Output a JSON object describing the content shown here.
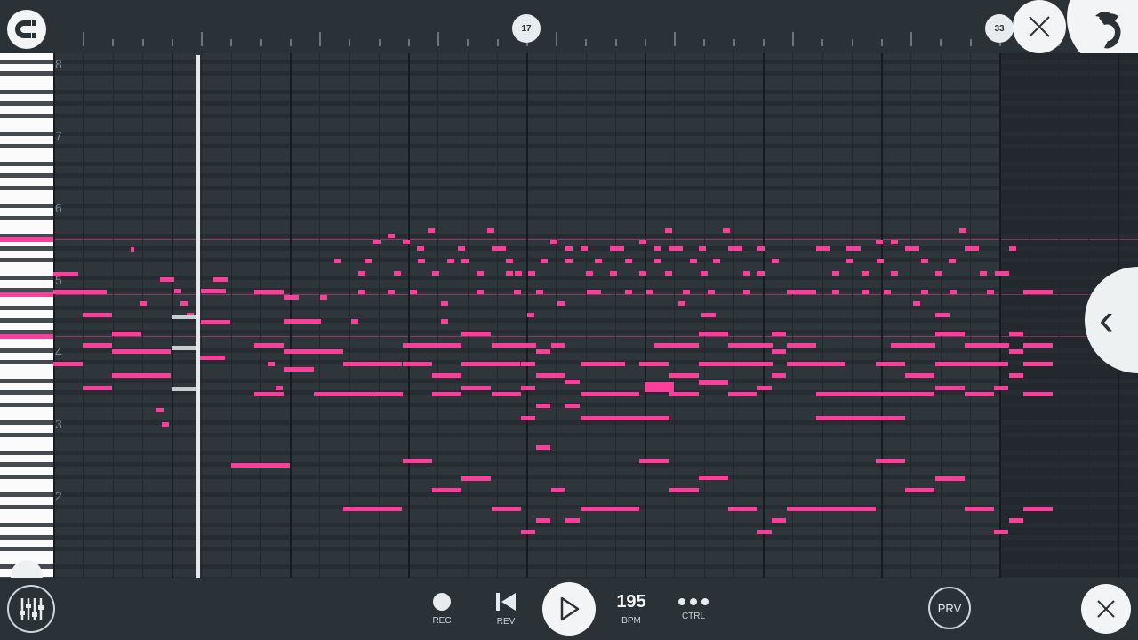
{
  "toolbar_top": {
    "markers": [
      {
        "label": "17"
      },
      {
        "label": "33"
      }
    ]
  },
  "octave_labels": [
    "8",
    "7",
    "6",
    "5",
    "4",
    "3",
    "2"
  ],
  "bottom_bar": {
    "rec_label": "REC",
    "rev_label": "REV",
    "bpm_value": "195",
    "bpm_label": "BPM",
    "ctrl_label": "CTRL",
    "prv_label": "PRV"
  },
  "colors": {
    "note": "#ff3d9b",
    "background": "#2e353b",
    "bar": "#2a3137",
    "accent_light": "#f2f4f5"
  },
  "icons": {
    "top_left": "magnet-snap-icon",
    "top_close": "close-icon",
    "top_right": "fl-studio-fruit-icon",
    "side": "chevron-left-icon",
    "mixer": "mixer-sliders-icon",
    "rec": "record-dot-icon",
    "rev": "skip-back-icon",
    "play": "play-icon",
    "ctrl": "more-dots-icon",
    "bottom_close": "close-icon"
  }
}
